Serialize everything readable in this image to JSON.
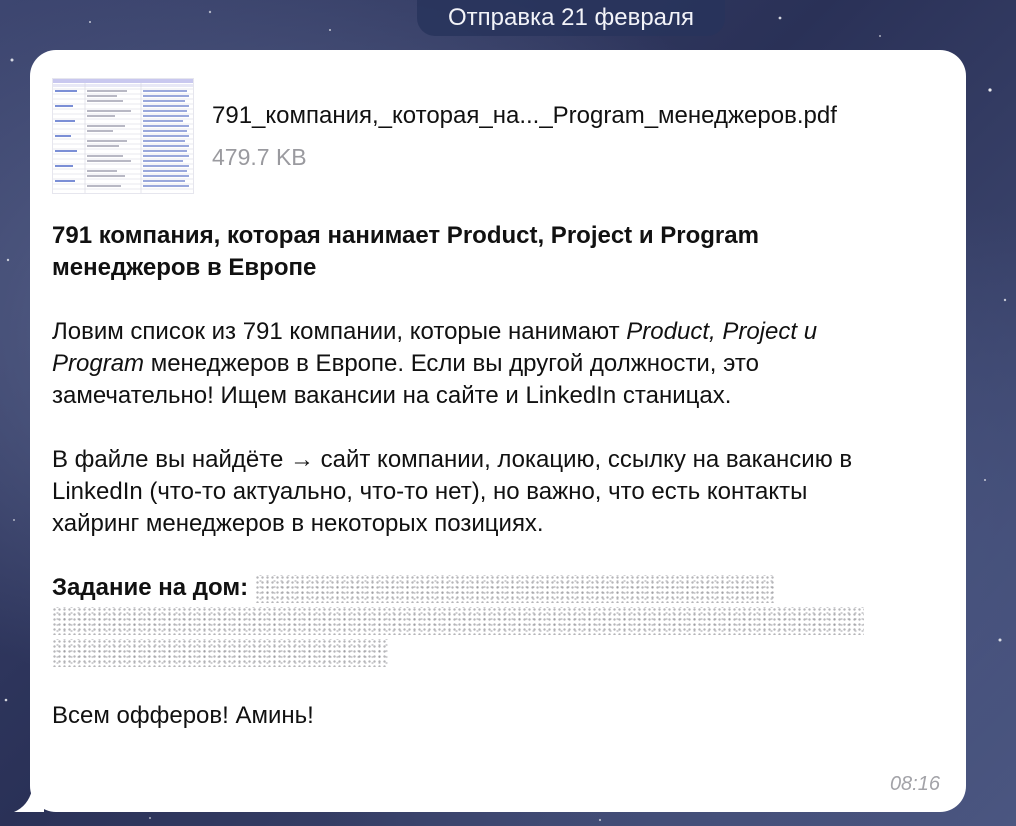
{
  "date_separator": "Отправка 21 февраля",
  "attachment": {
    "file_name": "791_компания,_которая_на..._Program_менеджеров.pdf",
    "file_size": "479.7 KB",
    "icon": "pdf-preview-thumbnail"
  },
  "message": {
    "heading_line1": "791 компания, которая нанимает Product, Project и Program",
    "heading_line2": "менеджеров в Европе",
    "para1_part1": "Ловим список из 791 компании, которые нанимают ",
    "para1_italic": "Product, Project и Program",
    "para1_part2": " менеджеров в Европе. Если вы другой должности, это замечательно! Ищем вакансии на сайте и LinkedIn станицах.",
    "para2": "В файле вы найдёте → сайт компании, локацию, ссылку на вакансию в LinkedIn (что-то актуально, что-то нет), но важно, что есть контакты хайринг менеджеров в некоторых позициях.",
    "task_label": "Задание на дом:",
    "closing": "Всем офферов! Аминь!",
    "time": "08:16"
  }
}
